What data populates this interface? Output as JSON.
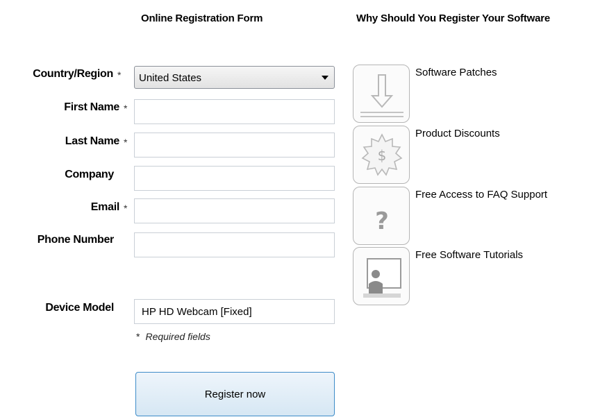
{
  "headings": {
    "form_title": "Online Registration Form",
    "why_title": "Why Should You Register Your Software"
  },
  "form": {
    "country": {
      "label": "Country/Region",
      "value": "United States",
      "required": true
    },
    "first_name": {
      "label": "First Name",
      "value": "",
      "required": true
    },
    "last_name": {
      "label": "Last Name",
      "value": "",
      "required": true
    },
    "company": {
      "label": "Company",
      "value": "",
      "required": false
    },
    "email": {
      "label": "Email",
      "value": "",
      "required": true
    },
    "phone": {
      "label": "Phone Number",
      "value": "",
      "required": false
    },
    "device_model": {
      "label": "Device Model",
      "value": "HP HD Webcam [Fixed]"
    },
    "required_marker": "*",
    "required_note": "Required fields",
    "submit_label": "Register now"
  },
  "benefits": [
    {
      "label": "Software Patches",
      "icon": "download-arrow-icon"
    },
    {
      "label": "Product Discounts",
      "icon": "dollar-badge-icon"
    },
    {
      "label": "Free Access to FAQ  Support",
      "icon": "question-mark-icon"
    },
    {
      "label": "Free Software Tutorials",
      "icon": "presenter-board-icon"
    }
  ],
  "colors": {
    "button_border": "#3c8bc8",
    "icon_gray": "#c4c4c4",
    "field_border": "#c9cfd6"
  }
}
